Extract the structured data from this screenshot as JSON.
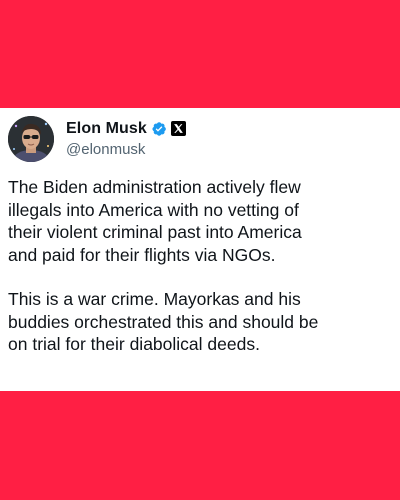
{
  "post": {
    "author": {
      "display_name": "Elon Musk",
      "handle": "@elonmusk",
      "verified_icon": "verified-check-icon",
      "badge_icon": "x-logo-icon"
    },
    "paragraphs": [
      "The Biden administration actively flew\nillegals into America with no vetting of\ntheir violent criminal past into America\nand paid for their flights via NGOs.",
      "This is a war crime. Mayorkas and his\nbuddies orchestrated this and should be\non trial for their diabolical deeds."
    ]
  },
  "colors": {
    "background": "#ff1f44",
    "card": "#ffffff",
    "verified": "#1d9bf0",
    "text": "#0f1419",
    "handle": "#536471"
  }
}
